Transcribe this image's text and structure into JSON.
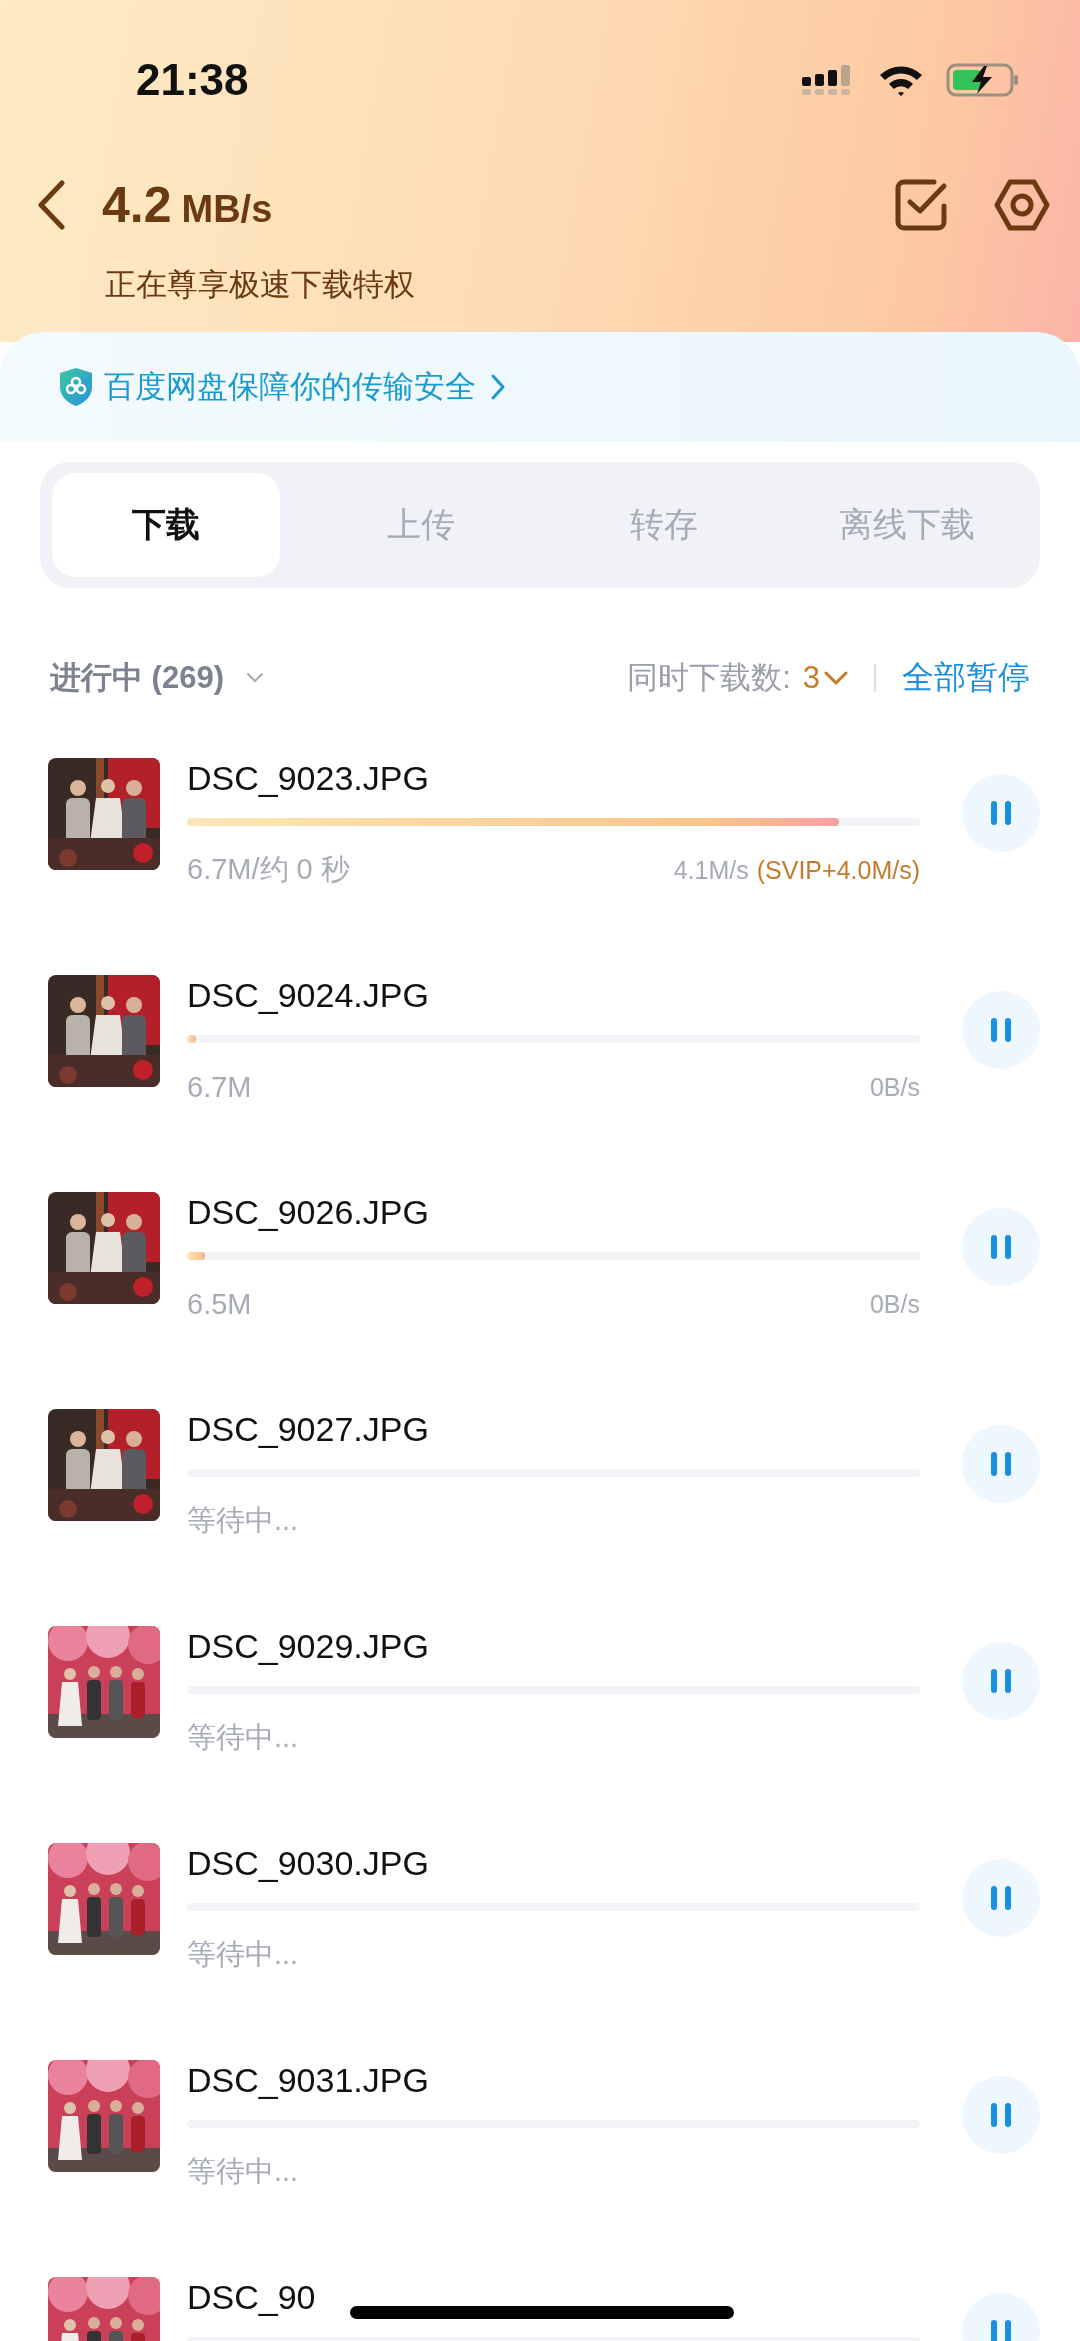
{
  "status_bar": {
    "time": "21:38"
  },
  "header": {
    "speed_value": "4.2",
    "speed_unit": "MB/s",
    "subtitle": "正在尊享极速下载特权"
  },
  "banner": {
    "text": "百度网盘保障你的传输安全"
  },
  "tabs": [
    {
      "label": "下载",
      "selected": true
    },
    {
      "label": "上传",
      "selected": false
    },
    {
      "label": "转存",
      "selected": false
    },
    {
      "label": "离线下载",
      "selected": false
    }
  ],
  "filter": {
    "label": "进行中 (269)",
    "concurrent_label": "同时下载数:",
    "concurrent_value": "3",
    "pause_all": "全部暂停"
  },
  "tasks": [
    {
      "name": "DSC_9023.JPG",
      "level": 0.89,
      "status": "6.7M/约 0 秒",
      "speed": "4.1M/s",
      "bonus": "(SVIP+4.0M/s)"
    },
    {
      "name": "DSC_9024.JPG",
      "level": 0.012,
      "status": "6.7M",
      "speed": "0B/s"
    },
    {
      "name": "DSC_9026.JPG",
      "level": 0.025,
      "status": "6.5M",
      "speed": "0B/s"
    },
    {
      "name": "DSC_9027.JPG",
      "status": "等待中..."
    },
    {
      "name": "DSC_9029.JPG",
      "status": "等待中..."
    },
    {
      "name": "DSC_9030.JPG",
      "status": "等待中..."
    },
    {
      "name": "DSC_9031.JPG",
      "status": "等待中..."
    },
    {
      "name": "DSC_90"
    }
  ]
}
